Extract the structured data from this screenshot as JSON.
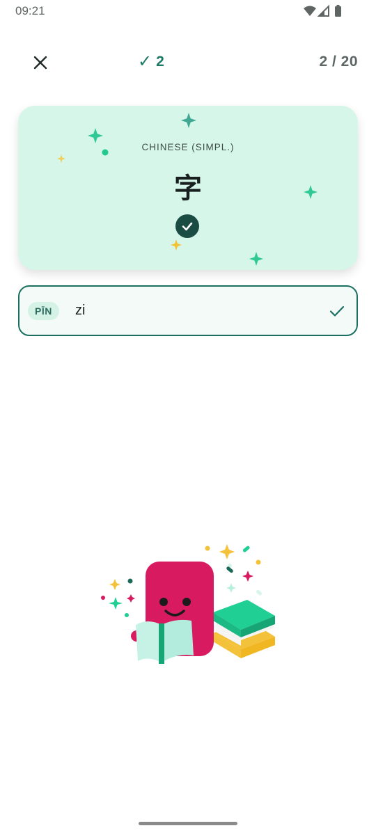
{
  "status_bar": {
    "time": "09:21",
    "icons": [
      "wifi-icon",
      "signal-icon",
      "battery-icon"
    ]
  },
  "top_bar": {
    "close_icon": "close-icon",
    "streak_check": "✓",
    "streak_count": "2",
    "progress": "2 / 20"
  },
  "card": {
    "language": "CHINESE (SIMPL.)",
    "character": "字",
    "status_icon": "check-circle-icon"
  },
  "answer": {
    "badge": "PĪN",
    "value": "zi",
    "status_icon": "check-icon"
  },
  "colors": {
    "accent": "#1d7a67",
    "card_bg": "#d6f6e9",
    "field_border": "#1a6f60",
    "mascot": "#d81b60",
    "book_green": "#1fcf94",
    "book_yellow": "#f4c23a"
  }
}
